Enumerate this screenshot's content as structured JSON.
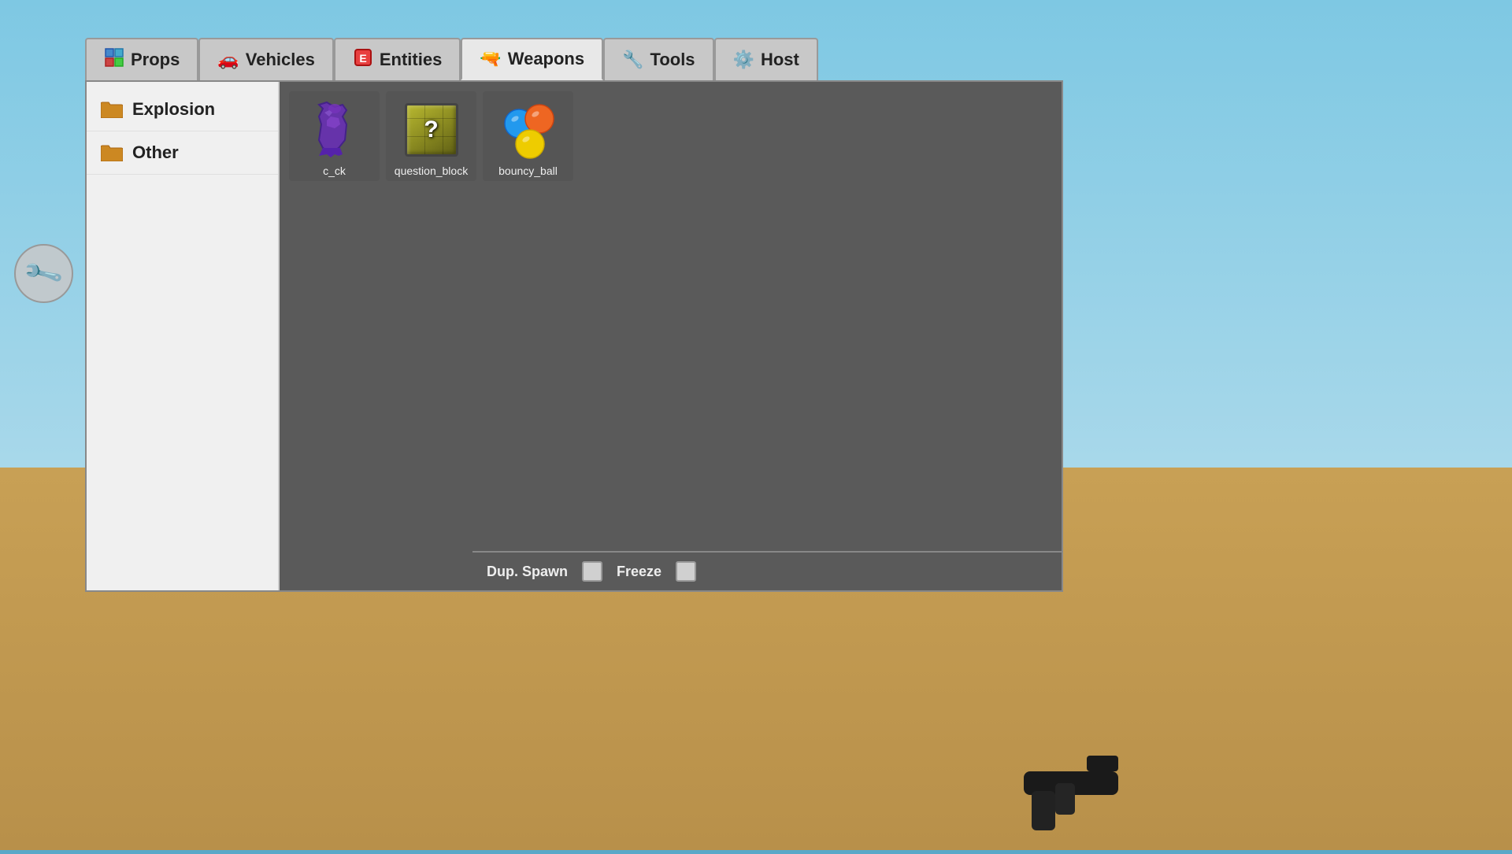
{
  "background": {
    "sky_color": "#7ec8e3",
    "ground_color": "#c8a055"
  },
  "tabs": [
    {
      "id": "props",
      "label": "Props",
      "icon": "🧊",
      "active": false
    },
    {
      "id": "vehicles",
      "label": "Vehicles",
      "icon": "🚗",
      "active": false
    },
    {
      "id": "entities",
      "label": "Entities",
      "icon": "📦",
      "active": false
    },
    {
      "id": "weapons",
      "label": "Weapons",
      "icon": "🔫",
      "active": true
    },
    {
      "id": "tools",
      "label": "Tools",
      "icon": "🔧",
      "active": false
    },
    {
      "id": "host",
      "label": "Host",
      "icon": "⚙️",
      "active": false
    }
  ],
  "sidebar": {
    "items": [
      {
        "id": "explosion",
        "label": "Explosion",
        "icon": "folder"
      },
      {
        "id": "other",
        "label": "Other",
        "icon": "folder"
      }
    ]
  },
  "grid": {
    "items": [
      {
        "id": "c_ck",
        "label": "c_ck",
        "type": "cck"
      },
      {
        "id": "question_block",
        "label": "question_block",
        "type": "question_block"
      },
      {
        "id": "bouncy_ball",
        "label": "bouncy_ball",
        "type": "bouncy_ball"
      }
    ]
  },
  "bottom_bar": {
    "dup_spawn_label": "Dup. Spawn",
    "freeze_label": "Freeze"
  },
  "tools_circle": {
    "icon": "🔧"
  }
}
